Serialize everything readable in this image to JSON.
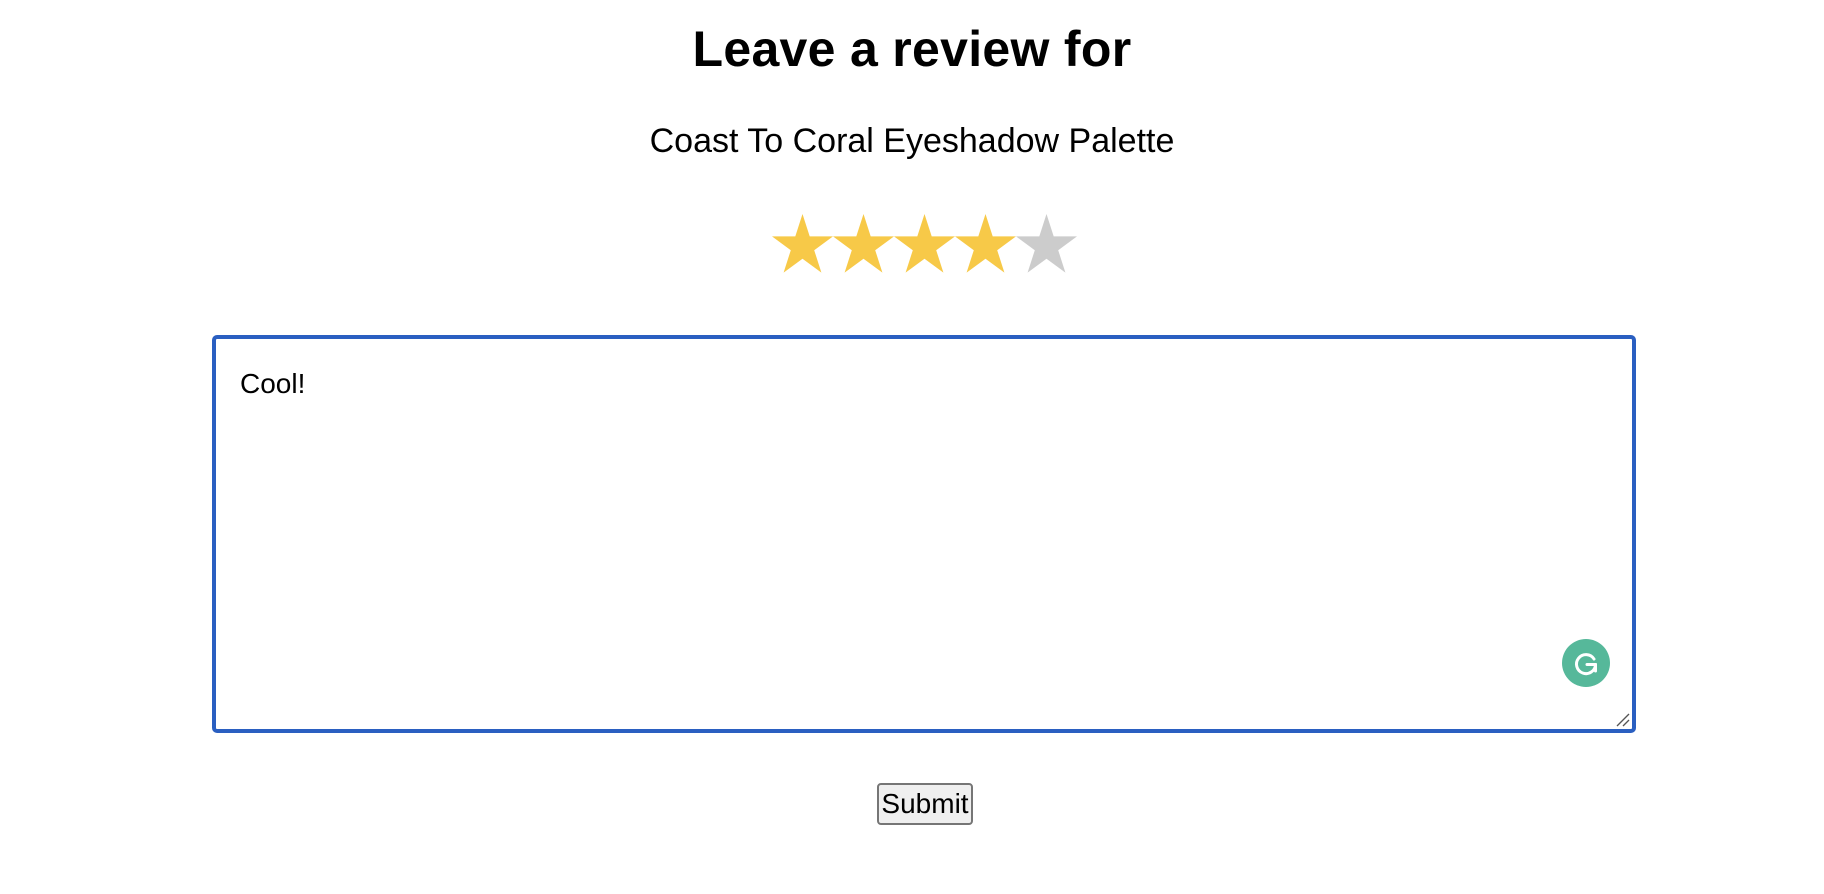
{
  "header": {
    "title": "Leave a review for",
    "product_name": "Coast To Coral Eyeshadow Palette"
  },
  "rating": {
    "value": 4,
    "max": 5,
    "filled_color": "#f7c948",
    "empty_color": "#cccccc"
  },
  "review": {
    "text": "Cool!",
    "border_color": "#2a5fc1"
  },
  "grammarly": {
    "icon": "grammarly-icon",
    "color": "#56b89a"
  },
  "form": {
    "submit_label": "Submit"
  }
}
